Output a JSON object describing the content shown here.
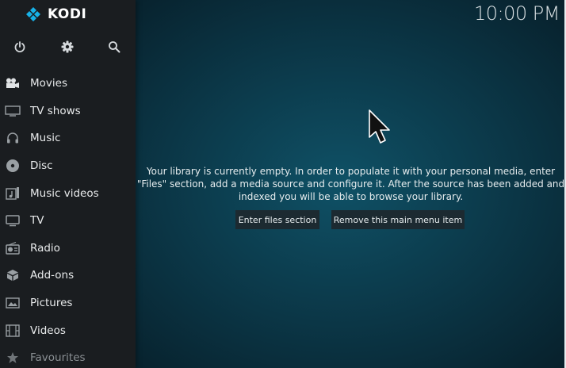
{
  "app": {
    "name": "KODI",
    "clock": "10:00 PM"
  },
  "top_icons": [
    {
      "name": "power-icon"
    },
    {
      "name": "settings-gear-icon"
    },
    {
      "name": "search-icon"
    }
  ],
  "menu": {
    "items": [
      {
        "label": "Movies",
        "icon": "movie-camera-icon"
      },
      {
        "label": "TV shows",
        "icon": "tv-screen-icon"
      },
      {
        "label": "Music",
        "icon": "headphones-icon"
      },
      {
        "label": "Disc",
        "icon": "disc-icon"
      },
      {
        "label": "Music videos",
        "icon": "music-video-icon"
      },
      {
        "label": "TV",
        "icon": "tv-icon"
      },
      {
        "label": "Radio",
        "icon": "radio-icon"
      },
      {
        "label": "Add-ons",
        "icon": "addons-box-icon"
      },
      {
        "label": "Pictures",
        "icon": "picture-icon"
      },
      {
        "label": "Videos",
        "icon": "film-strip-icon"
      },
      {
        "label": "Favourites",
        "icon": "star-icon"
      }
    ]
  },
  "main": {
    "message_lines": [
      "Your library is currently empty. In order to populate it with your personal media, enter",
      "\"Files\" section, add a media source and configure it. After the source has been added and",
      "indexed you will be able to browse your library."
    ],
    "enter_files_label": "Enter files section",
    "remove_item_label": "Remove this main menu item"
  },
  "colors": {
    "sidebar": "#1a1d20",
    "background_center": "#0f5166",
    "kodi_blue": "#17b2e7",
    "button_bg": "#1c2a31"
  }
}
